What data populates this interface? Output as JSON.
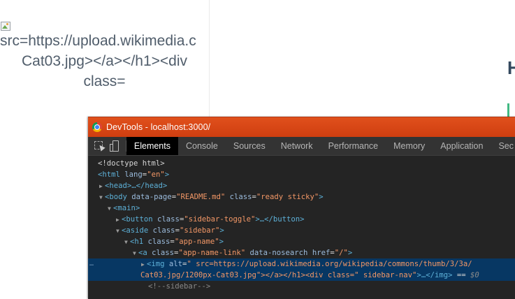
{
  "page": {
    "alt_lines": [
      "src=https://upload.wikimedia.c",
      "Cat03.jpg></a></h1><div",
      "class="
    ],
    "heading_fragment": "H"
  },
  "devtools": {
    "title": "DevTools - localhost:3000/",
    "tabs": [
      {
        "label": "Elements"
      },
      {
        "label": "Console"
      },
      {
        "label": "Sources"
      },
      {
        "label": "Network"
      },
      {
        "label": "Performance"
      },
      {
        "label": "Memory"
      },
      {
        "label": "Application"
      },
      {
        "label": "Sec"
      }
    ],
    "dom": {
      "doctype": "<!doctype html>",
      "html_open": "<html",
      "html_attr": "lang",
      "html_val": "\"en\"",
      "html_close": ">",
      "head": "<head>…</head>",
      "body_tag": "<body",
      "body_attr1": "data-page",
      "body_val1": "\"README.md\"",
      "body_attr2": "class",
      "body_val2": "\"ready sticky\"",
      "body_close": ">",
      "main": "<main>",
      "button_tag": "<button",
      "button_attr": "class",
      "button_val": "\"sidebar-toggle\"",
      "button_close": ">…</button>",
      "aside_tag": "<aside",
      "aside_attr": "class",
      "aside_val": "\"sidebar\"",
      "aside_close": ">",
      "h1_tag": "<h1",
      "h1_attr": "class",
      "h1_val": "\"app-name\"",
      "h1_close": ">",
      "a_tag": "<a",
      "a_attr1": "class",
      "a_val1": "\"app-name-link\"",
      "a_attr2": "data-nosearch",
      "a_attr3": "href",
      "a_val3": "\"/\"",
      "a_close": ">",
      "img_tag": "<img",
      "img_attr1": "alt",
      "img_val1": "\" src=https://upload.wikimedia.org/wikipedia/commons/thumb/3/3a/",
      "img_val1b": "Cat03.jpg/1200px-Cat03.jpg\"></a></h1><div class=\" sidebar-nav\"",
      "img_close": ">…</img>",
      "img_eq": " == ",
      "img_dollar": "$0",
      "comment": "<!--sidebar-->",
      "dots": "…"
    }
  }
}
